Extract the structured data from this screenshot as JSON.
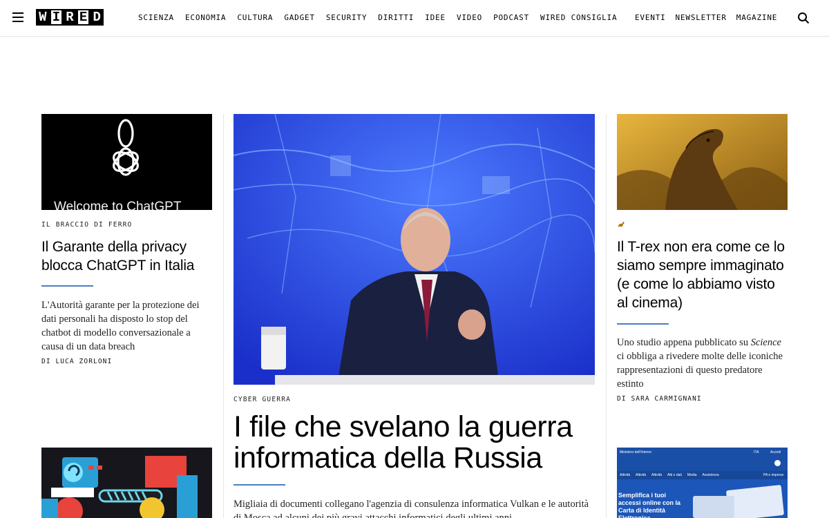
{
  "header": {
    "logo_letters": [
      "W",
      "I",
      "R",
      "E",
      "D"
    ],
    "nav": [
      "SCIENZA",
      "ECONOMIA",
      "CULTURA",
      "GADGET",
      "SECURITY",
      "DIRITTI",
      "IDEE",
      "VIDEO",
      "PODCAST",
      "WIRED CONSIGLIA"
    ],
    "nav_right": [
      "EVENTI",
      "NEWSLETTER",
      "MAGAZINE"
    ]
  },
  "left_article": {
    "image_text": "Welcome to ChatGPT",
    "rubric": "IL BRACCIO DI FERRO",
    "headline": "Il Garante della privacy blocca ChatGPT in Italia",
    "dek": "L'Autorità garante per la protezione dei dati personali ha disposto lo stop del chatbot di modello conversazionale a causa di un data breach",
    "byline": "DI LUCA ZORLONI"
  },
  "center_article": {
    "rubric": "CYBER GUERRA",
    "headline": "I file che svelano la guerra informatica della Russia",
    "dek": "Migliaia di documenti collegano l'agenzia di consulenza informatica Vulkan e le autorità di Mosca ad alcuni dei più gravi attacchi informatici degli ultimi anni"
  },
  "right_article": {
    "headline": "Il T-rex non era come ce lo siamo sempre immaginato (e come lo abbiamo visto al cinema)",
    "dek_prefix": "Uno studio appena pubblicato su ",
    "dek_italic": "Science",
    "dek_suffix": " ci obbliga a rivedere molte delle iconiche rappresentazioni di questo predatore estinto",
    "byline": "DI SARA CARMIGNANI"
  },
  "right_bottom_image": {
    "site_label": "Ministero dell'Interno",
    "nav_items": [
      "Attività",
      "Attività",
      "Attività",
      "Atti e dati",
      "Media",
      "Assistenza"
    ],
    "promo_text": "Semplifica i tuoi accessi online con la Carta di Identità Elettronica",
    "top_right": "ITA",
    "login_label": "Accedi",
    "side_label": "PA e imprese"
  },
  "colors": {
    "accent_rule": "#4a7ec2",
    "chatgpt_bg": "#000000",
    "putin_bg": "#1f3fd6",
    "trex_bg": "#c8901e",
    "cie_bg": "#1c56b8"
  }
}
